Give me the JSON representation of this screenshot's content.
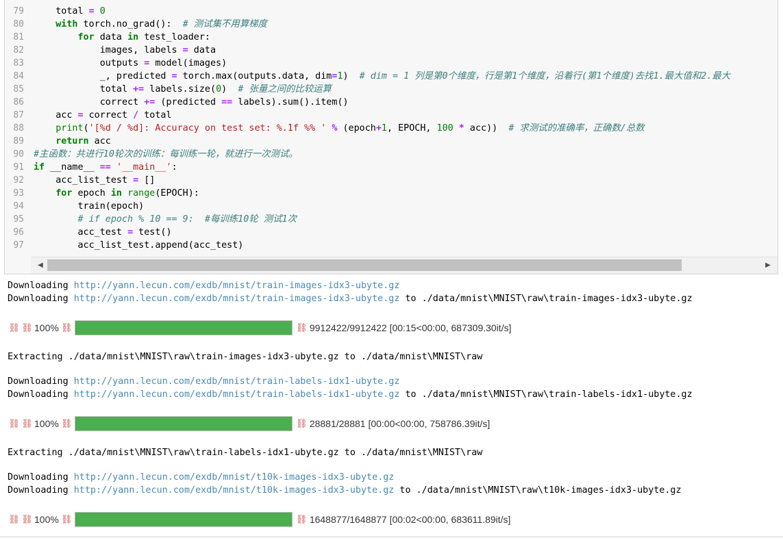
{
  "code": {
    "lines": [
      {
        "no": "79",
        "tokens": [
          [
            "",
            "    total "
          ],
          [
            "op",
            "="
          ],
          [
            "nm",
            " 0"
          ]
        ]
      },
      {
        "no": "80",
        "tokens": [
          [
            "kw",
            "    with"
          ],
          [
            "",
            " torch.no_grad():  "
          ],
          [
            "cm",
            "# 测试集不用算梯度"
          ]
        ]
      },
      {
        "no": "81",
        "tokens": [
          [
            "kw",
            "        for"
          ],
          [
            "",
            " data "
          ],
          [
            "kw",
            "in"
          ],
          [
            "",
            " test_loader:"
          ]
        ]
      },
      {
        "no": "82",
        "tokens": [
          [
            "",
            "            images, labels "
          ],
          [
            "op",
            "="
          ],
          [
            "",
            " data"
          ]
        ]
      },
      {
        "no": "83",
        "tokens": [
          [
            "",
            "            outputs "
          ],
          [
            "op",
            "="
          ],
          [
            "",
            " model(images)"
          ]
        ]
      },
      {
        "no": "84",
        "tokens": [
          [
            "",
            "            _, predicted "
          ],
          [
            "op",
            "="
          ],
          [
            "",
            " torch.max(outputs.data, dim"
          ],
          [
            "op",
            "="
          ],
          [
            "nm",
            "1"
          ],
          [
            "",
            ")  "
          ],
          [
            "cm",
            "# dim = 1 列是第0个维度，行是第1个维度，沿着行(第1个维度)去找1.最大值和2.最大"
          ]
        ]
      },
      {
        "no": "85",
        "tokens": [
          [
            "",
            "            total "
          ],
          [
            "op",
            "+="
          ],
          [
            "",
            " labels.size("
          ],
          [
            "nm",
            "0"
          ],
          [
            "",
            ")  "
          ],
          [
            "cm",
            "# 张量之间的比较运算"
          ]
        ]
      },
      {
        "no": "86",
        "tokens": [
          [
            "",
            "            correct "
          ],
          [
            "op",
            "+="
          ],
          [
            "",
            " (predicted "
          ],
          [
            "op",
            "=="
          ],
          [
            "",
            " labels).sum().item()"
          ]
        ]
      },
      {
        "no": "87",
        "tokens": [
          [
            "",
            "    acc "
          ],
          [
            "op",
            "="
          ],
          [
            "",
            " correct "
          ],
          [
            "op",
            "/"
          ],
          [
            "",
            " total"
          ]
        ]
      },
      {
        "no": "88",
        "tokens": [
          [
            "bi",
            "    print"
          ],
          [
            "",
            "("
          ],
          [
            "st",
            "'[%d / %d]: Accuracy on test set: %.1f %% '"
          ],
          [
            "",
            " "
          ],
          [
            "op",
            "%"
          ],
          [
            "",
            " (epoch"
          ],
          [
            "op",
            "+"
          ],
          [
            "nm",
            "1"
          ],
          [
            "",
            ", EPOCH, "
          ],
          [
            "nm",
            "100"
          ],
          [
            "",
            " "
          ],
          [
            "op",
            "*"
          ],
          [
            "",
            " acc))  "
          ],
          [
            "cm",
            "# 求测试的准确率，正确数/总数"
          ]
        ]
      },
      {
        "no": "89",
        "tokens": [
          [
            "kw",
            "    return"
          ],
          [
            "",
            " acc"
          ]
        ]
      },
      {
        "no": "90",
        "tokens": [
          [
            "cm",
            "#主函数：共进行10轮次的训练：每训练一轮，就进行一次测试。"
          ]
        ]
      },
      {
        "no": "91",
        "tokens": [
          [
            "kw",
            "if"
          ],
          [
            "",
            " __name__ "
          ],
          [
            "op",
            "=="
          ],
          [
            "",
            " "
          ],
          [
            "st",
            "'__main__'"
          ],
          [
            "",
            ":"
          ]
        ]
      },
      {
        "no": "92",
        "tokens": [
          [
            "",
            "    acc_list_test "
          ],
          [
            "op",
            "="
          ],
          [
            "",
            " []"
          ]
        ]
      },
      {
        "no": "93",
        "tokens": [
          [
            "kw",
            "    for"
          ],
          [
            "",
            " epoch "
          ],
          [
            "kw",
            "in"
          ],
          [
            "",
            " "
          ],
          [
            "bi",
            "range"
          ],
          [
            "",
            "(EPOCH):"
          ]
        ]
      },
      {
        "no": "94",
        "tokens": [
          [
            "",
            "        train(epoch)"
          ]
        ]
      },
      {
        "no": "95",
        "tokens": [
          [
            "cm",
            "        # if epoch % 10 == 9:  #每训练10轮 测试1次"
          ]
        ]
      },
      {
        "no": "96",
        "tokens": [
          [
            "",
            "        acc_test "
          ],
          [
            "op",
            "="
          ],
          [
            "",
            " test()"
          ]
        ]
      },
      {
        "no": "97",
        "tokens": [
          [
            "",
            "        acc_list_test.append(acc_test)"
          ]
        ]
      }
    ]
  },
  "scrollbar": {
    "left_arrow": "◀",
    "right_arrow": "▶"
  },
  "output": {
    "blocks": [
      {
        "kind": "line",
        "prefix": "Downloading ",
        "link": "http://yann.lecun.com/exdb/mnist/train-images-idx3-ubyte.gz",
        "suffix": ""
      },
      {
        "kind": "line",
        "prefix": "Downloading ",
        "link": "http://yann.lecun.com/exdb/mnist/train-images-idx3-ubyte.gz",
        "suffix": " to ./data/mnist\\MNIST\\raw\\train-images-idx3-ubyte.gz"
      },
      {
        "kind": "blank"
      },
      {
        "kind": "progress",
        "percent_label": "100%",
        "fraction": 1.0,
        "stats": "9912422/9912422 [00:15<00:00, 687309.30it/s]"
      },
      {
        "kind": "blank"
      },
      {
        "kind": "line",
        "prefix": "Extracting ./data/mnist\\MNIST\\raw\\train-images-idx3-ubyte.gz to ./data/mnist\\MNIST\\raw",
        "link": "",
        "suffix": ""
      },
      {
        "kind": "blank"
      },
      {
        "kind": "line",
        "prefix": "Downloading ",
        "link": "http://yann.lecun.com/exdb/mnist/train-labels-idx1-ubyte.gz",
        "suffix": ""
      },
      {
        "kind": "line",
        "prefix": "Downloading ",
        "link": "http://yann.lecun.com/exdb/mnist/train-labels-idx1-ubyte.gz",
        "suffix": " to ./data/mnist\\MNIST\\raw\\train-labels-idx1-ubyte.gz"
      },
      {
        "kind": "blank"
      },
      {
        "kind": "progress",
        "percent_label": "100%",
        "fraction": 1.0,
        "stats": "28881/28881 [00:00<00:00, 758786.39it/s]"
      },
      {
        "kind": "blank"
      },
      {
        "kind": "line",
        "prefix": "Extracting ./data/mnist\\MNIST\\raw\\train-labels-idx1-ubyte.gz to ./data/mnist\\MNIST\\raw",
        "link": "",
        "suffix": ""
      },
      {
        "kind": "blank"
      },
      {
        "kind": "line",
        "prefix": "Downloading ",
        "link": "http://yann.lecun.com/exdb/mnist/t10k-images-idx3-ubyte.gz",
        "suffix": ""
      },
      {
        "kind": "line",
        "prefix": "Downloading ",
        "link": "http://yann.lecun.com/exdb/mnist/t10k-images-idx3-ubyte.gz",
        "suffix": " to ./data/mnist\\MNIST\\raw\\t10k-images-idx3-ubyte.gz"
      },
      {
        "kind": "blank"
      },
      {
        "kind": "progress",
        "percent_label": "100%",
        "fraction": 1.0,
        "stats": "1648877/1648877 [00:02<00:00, 683611.89it/s]"
      }
    ]
  },
  "icons": {
    "broken_link": "broken-image-icon"
  },
  "colors": {
    "progress_fill": "#4cae4f",
    "link": "#4a8ab0",
    "comment": "#408080"
  }
}
